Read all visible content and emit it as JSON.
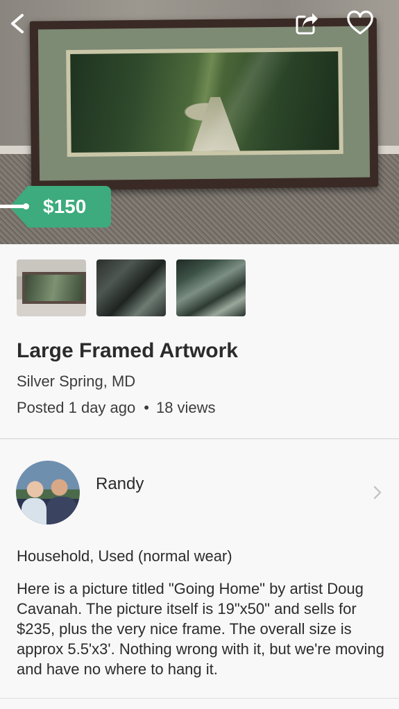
{
  "listing": {
    "price": "$150",
    "title": "Large Framed Artwork",
    "location": "Silver Spring, MD",
    "posted": "Posted 1 day ago",
    "separator": "•",
    "views": "18 views",
    "condition": "Household, Used (normal wear)",
    "description": "Here is a picture titled \"Going Home\" by artist Doug Cavanah. The picture itself is 19\"x50\" and sells for $235, plus the very nice frame. The overall size is approx 5.5'x3'. Nothing wrong with it, but we're moving and have no where to hang it."
  },
  "seller": {
    "name": "Randy"
  },
  "icons": {
    "back": "chevron-left-icon",
    "share": "share-icon",
    "favorite": "heart-outline-icon",
    "seller_link": "chevron-right-icon"
  },
  "colors": {
    "price_tag": "#3dab7d"
  }
}
